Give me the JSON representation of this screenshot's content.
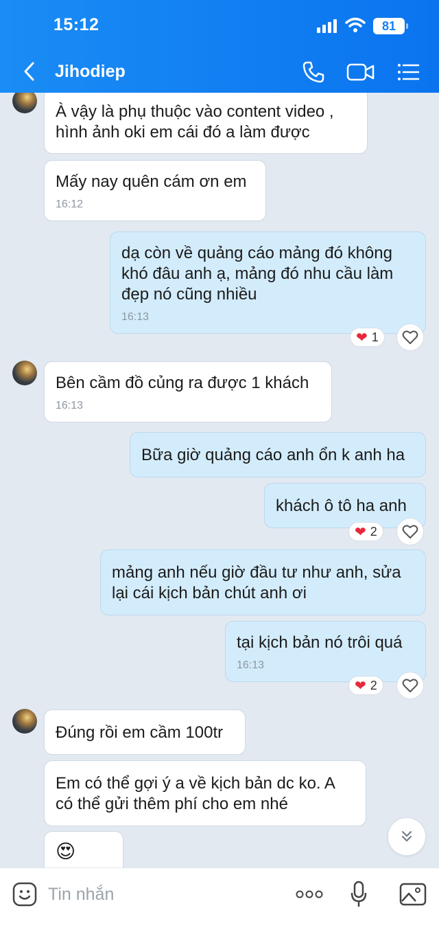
{
  "status": {
    "time": "15:12",
    "battery": "81"
  },
  "header": {
    "title": "Jihodiep"
  },
  "messages": [
    {
      "text": "À vậy là phụ thuộc vào content video ,\nhình ảnh oki em cái đó a làm được"
    },
    {
      "text": "Mấy nay quên cám ơn em",
      "time": "16:12"
    },
    {
      "text": "dạ còn về quảng cáo mảng đó không\nkhó đâu anh ạ, mảng đó nhu cầu làm\nđẹp nó  cũng nhiều",
      "time": "16:13",
      "reaction_count": "1"
    },
    {
      "text": "Bên cầm đồ củng ra được 1 khách",
      "time": "16:13"
    },
    {
      "text": "Bữa giờ quảng cáo anh ổn k anh ha"
    },
    {
      "text": "khách ô tô ha anh",
      "reaction_count": "2"
    },
    {
      "text": "mảng anh nếu giờ đầu tư như anh, sửa\nlại cái kịch bản chút anh ơi"
    },
    {
      "text": "tại kịch bản nó trôi quá",
      "time": "16:13",
      "reaction_count": "2"
    },
    {
      "text": "Đúng rồi em cầm 100tr"
    },
    {
      "text": "Em có thể gợi ý a về kịch bản dc ko. A\ncó thể gửi thêm phí cho em nhé"
    },
    {
      "text": "😍"
    }
  ],
  "input": {
    "placeholder": "Tin nhắn"
  },
  "colors": {
    "header": "#0a74ef",
    "outgoing_bubble": "#d3ecfc",
    "incoming_bubble": "#ffffff",
    "chat_bg": "#e2e9f1"
  }
}
